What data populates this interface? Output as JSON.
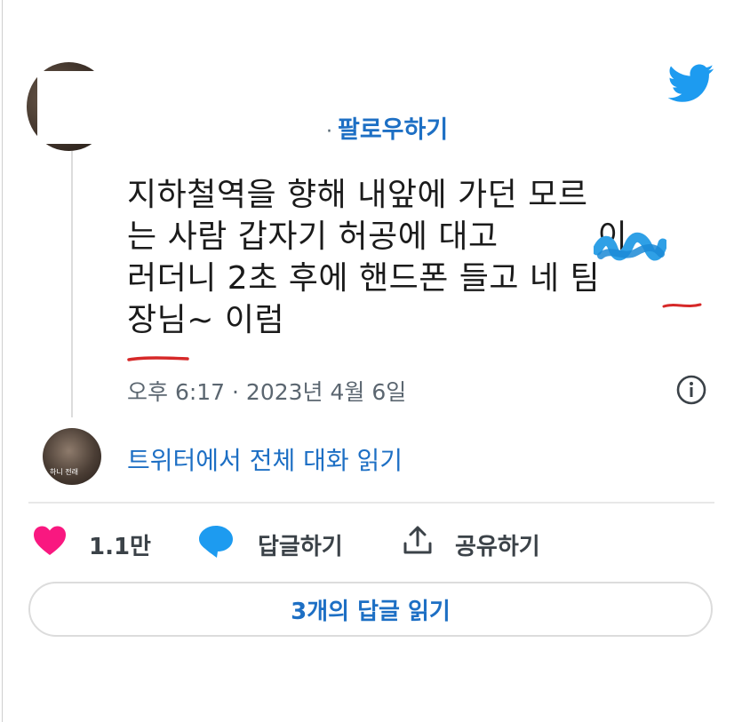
{
  "header": {
    "follow_label": "팔로우하기",
    "dot": "·",
    "brand_icon": "twitter-bird-icon",
    "brand_color": "#1d9bf0"
  },
  "tweet": {
    "line1": "지하철역을 향해 내앞에 가던 모르",
    "line2": "는 사람 갑자기 허공에 대고",
    "line2_suffix": "이",
    "line3": "러더니 2초 후에 핸드폰 들고 네 팀",
    "line4": "장님~ 이럼",
    "timestamp": "오후 6:17 · 2023년 4월 6일"
  },
  "conversation": {
    "read_full_label": "트위터에서 전체 대화 읽기",
    "avatar_caption": "하니 전래"
  },
  "actions": {
    "like_count": "1.1만",
    "reply_label": "답글하기",
    "share_label": "공유하기",
    "like_color": "#f91880",
    "reply_color": "#1d9bf0"
  },
  "replies_button": {
    "label": "3개의 답글 읽기"
  }
}
